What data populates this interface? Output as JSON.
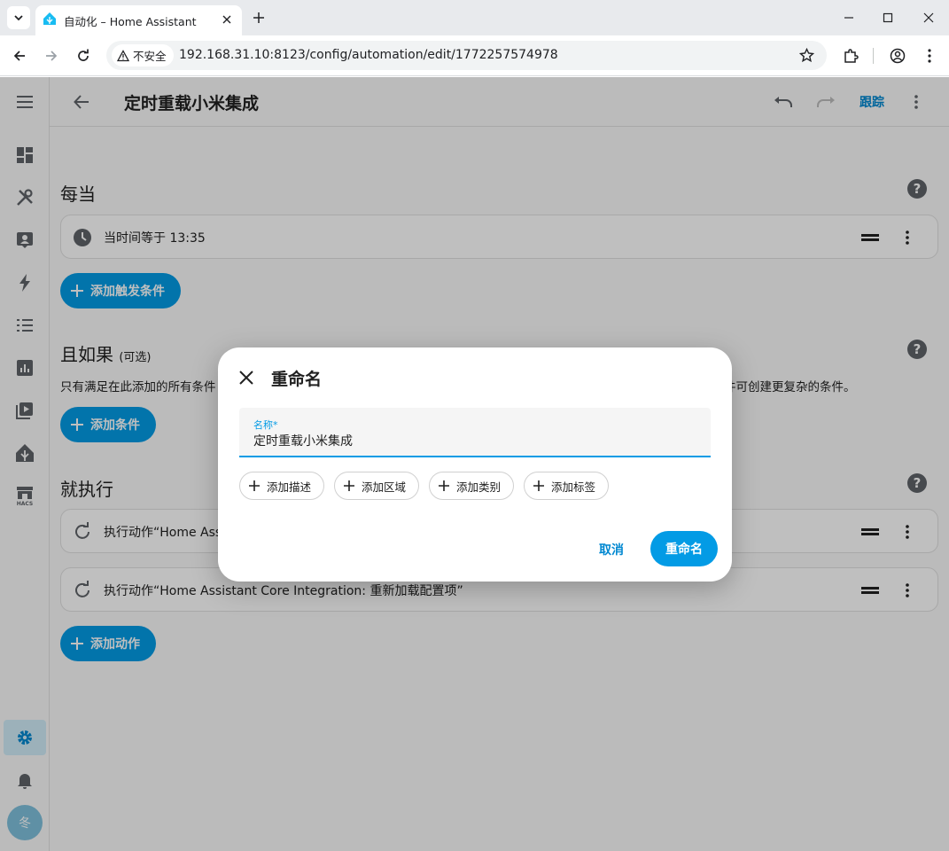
{
  "browser": {
    "tab_title": "自动化 – Home Assistant",
    "security_label": "不安全",
    "url": "192.168.31.10:8123/config/automation/edit/1772257574978"
  },
  "header": {
    "title": "定时重载小米集成",
    "trace_label": "跟踪"
  },
  "sidebar": {
    "items": [
      "dashboard-icon",
      "tools-icon",
      "people-icon",
      "energy-icon",
      "logbook-icon",
      "history-icon",
      "media-icon",
      "home-assistant-icon",
      "hacs-icon"
    ],
    "active": "settings-icon",
    "avatar_initial": "冬"
  },
  "triggers": {
    "title": "每当",
    "items": [
      {
        "label": "当时间等于 13:35",
        "icon": "clock-icon"
      }
    ],
    "add_label": "添加触发条件"
  },
  "conditions": {
    "title": "且如果",
    "optional_label": "(可选)",
    "description_start": "只有满足在此添加的所有条件",
    "description_end": "用组件可创建更复杂的条件。",
    "add_label": "添加条件"
  },
  "actions": {
    "title": "就执行",
    "items": [
      {
        "label": "执行动作“Home Assi",
        "icon": "refresh-icon"
      },
      {
        "label": "执行动作“Home Assistant Core Integration: 重新加载配置项”",
        "icon": "refresh-icon"
      }
    ],
    "add_label": "添加动作"
  },
  "dialog": {
    "title": "重命名",
    "field_label": "名称*",
    "field_value": "定时重载小米集成",
    "chips": [
      "添加描述",
      "添加区域",
      "添加类别",
      "添加标签"
    ],
    "cancel_label": "取消",
    "confirm_label": "重命名"
  },
  "colors": {
    "accent": "#039be5",
    "link": "#0288d1"
  }
}
